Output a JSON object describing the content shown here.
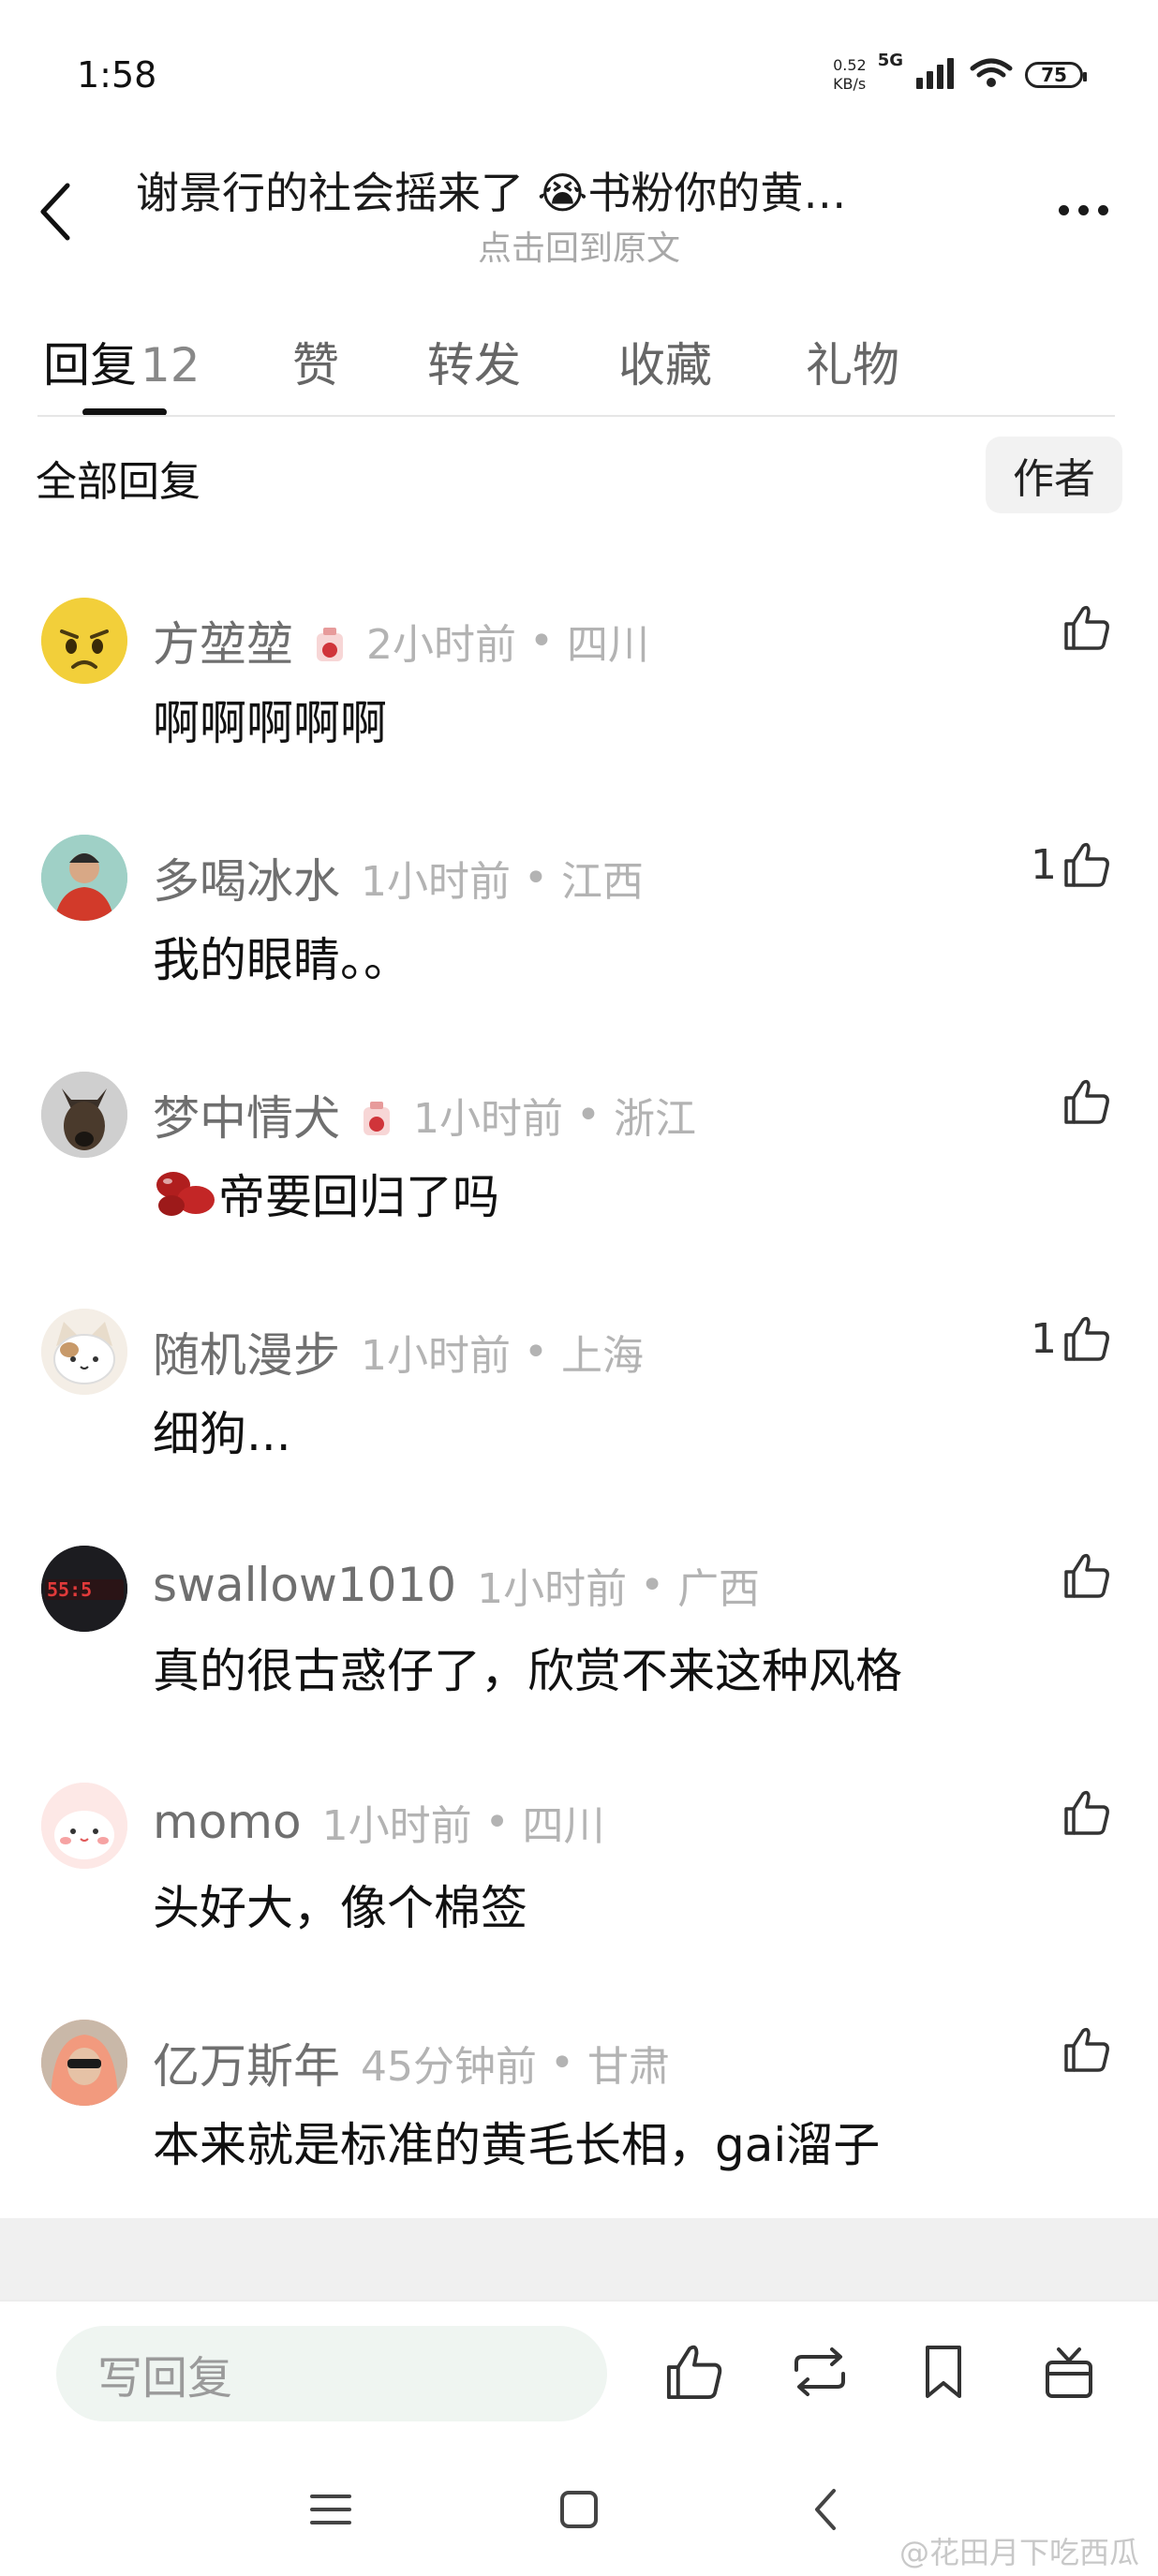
{
  "status_bar": {
    "time": "1:58",
    "net_speed_value": "0.52",
    "net_speed_unit": "KB/s",
    "network": "5G",
    "battery": "75"
  },
  "header": {
    "title": "谢景行的社会摇来了 😭书粉你的黄…",
    "subtitle": "点击回到原文"
  },
  "tabs": [
    {
      "label": "回复",
      "count": "12"
    },
    {
      "label": "赞"
    },
    {
      "label": "转发"
    },
    {
      "label": "收藏"
    },
    {
      "label": "礼物"
    }
  ],
  "section": {
    "title": "全部回复",
    "author_filter": "作者"
  },
  "comments": [
    {
      "username": "方堃堃",
      "time": "2小时前",
      "location": "四川",
      "text": "啊啊啊啊啊",
      "likes": ""
    },
    {
      "username": "多喝冰水",
      "time": "1小时前",
      "location": "江西",
      "text": "我的眼睛。。",
      "likes": "1"
    },
    {
      "username": "梦中情犬",
      "time": "1小时前",
      "location": "浙江",
      "text": "帝要回归了吗",
      "likes": ""
    },
    {
      "username": "随机漫步",
      "time": "1小时前",
      "location": "上海",
      "text": "细狗...",
      "likes": "1"
    },
    {
      "username": "swallow1010",
      "time": "1小时前",
      "location": "广西",
      "text": "真的很古惑仔了，欣赏不来这种风格",
      "likes": ""
    },
    {
      "username": "momo",
      "time": "1小时前",
      "location": "四川",
      "text": "头好大，像个棉签",
      "likes": ""
    },
    {
      "username": "亿万斯年",
      "time": "45分钟前",
      "location": "甘肃",
      "text": "本来就是标准的黄毛长相，gai溜子",
      "likes": ""
    }
  ],
  "separator": "•",
  "footer": {
    "reply_placeholder": "写回复"
  },
  "watermark": "@花田月下吃西瓜",
  "colors": {
    "accent": "#111111",
    "muted": "#b3b3b3",
    "input_bg": "#eff5f1"
  }
}
